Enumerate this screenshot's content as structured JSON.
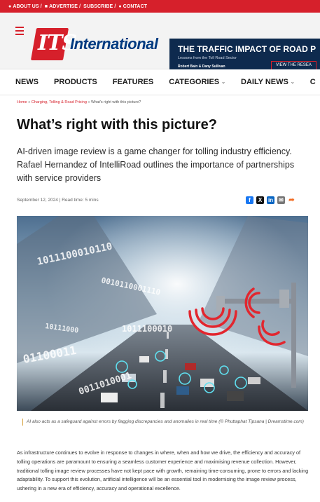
{
  "topbar": {
    "about": "ABOUT US /",
    "advertise": "ADVERTISE /",
    "subscribe": "SUBSCRIBE /",
    "contact": "CONTACT"
  },
  "header": {
    "logo_letters": "ITS",
    "logo_word": "International",
    "banner": {
      "title": "THE TRAFFIC IMPACT OF ROAD P",
      "subtitle": "Lessons from the Toll Road Sector",
      "authors": "Robert Bain & Dany Sullivan",
      "cta": "VIEW THE RESEA"
    }
  },
  "nav": {
    "items": [
      {
        "label": "NEWS",
        "has_dropdown": false
      },
      {
        "label": "PRODUCTS",
        "has_dropdown": false
      },
      {
        "label": "FEATURES",
        "has_dropdown": false
      },
      {
        "label": "CATEGORIES",
        "has_dropdown": true
      },
      {
        "label": "DAILY NEWS",
        "has_dropdown": true
      },
      {
        "label": "C",
        "has_dropdown": false
      }
    ]
  },
  "breadcrumb": {
    "home": "Home",
    "sep1": " » ",
    "category": "Charging, Tolling & Road Pricing",
    "sep2": " » ",
    "current": "What's right with this picture?"
  },
  "article": {
    "title": "What’s right with this picture?",
    "standfirst": "AI-driven image review is a game changer for tolling industry efficiency. Rafael Hernandez of IntelliRoad outlines the importance of partnerships with service providers",
    "meta": "September 12, 2024 | Read time: 5 mins",
    "caption": "AI also acts as a safeguard against errors by flagging discrepancies and anomalies in real time (© Phuttaphat Tipsana | Dreamstime.com)",
    "body": "As infrastructure continues to evolve in response to changes in where, when and how we drive, the efficiency and accuracy of tolling operations are paramount to ensuring a seamless customer experience and maximising revenue collection. However, traditional tolling image review processes have not kept pace with growth, remaining time-consuming, prone to errors and lacking adaptability. To support this evolution, artificial intelligence will be an essential tool in modernising the image review process, ushering in a new era of efficiency, accuracy and operational excellence."
  },
  "share": {
    "facebook": "f",
    "x": "X",
    "linkedin": "in",
    "email": "✉",
    "more": "➦"
  },
  "hero": {
    "stream1": "1011100010110",
    "stream2": "0010110001110",
    "stream3": "1011100010",
    "stream4": "01100011",
    "stream5": "10111000",
    "stream6": "0011010001"
  },
  "colors": {
    "brand_red": "#d6202b",
    "brand_blue": "#003a80",
    "banner_bg": "#0e2a4e"
  }
}
